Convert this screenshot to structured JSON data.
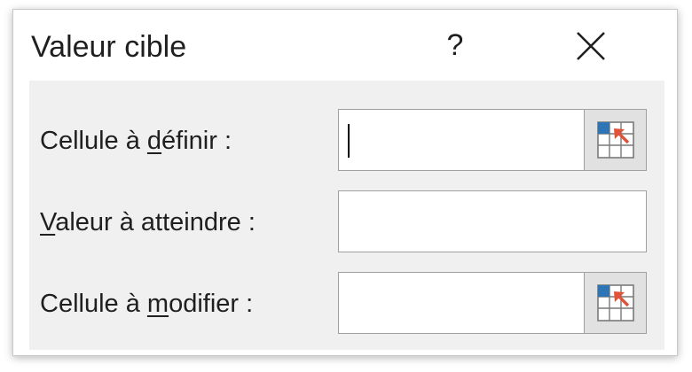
{
  "dialog": {
    "title": "Valeur cible",
    "help_label": "?"
  },
  "fields": [
    {
      "label_before": "Cellule à ",
      "label_key": "d",
      "label_after": "éfinir :",
      "value": "",
      "has_ref_button": true,
      "focused": true
    },
    {
      "label_before": "",
      "label_key": "V",
      "label_after": "aleur à atteindre :",
      "value": "",
      "has_ref_button": false,
      "focused": false
    },
    {
      "label_before": "Cellule à ",
      "label_key": "m",
      "label_after": "odifier :",
      "value": "",
      "has_ref_button": true,
      "focused": false
    }
  ],
  "icons": {
    "close": "close-icon",
    "range_selector": "range-selector-icon"
  },
  "colors": {
    "panel_background": "#f0f0f0",
    "range_icon_cell_blue": "#2e75b6",
    "range_icon_arrow": "#e0533a"
  }
}
